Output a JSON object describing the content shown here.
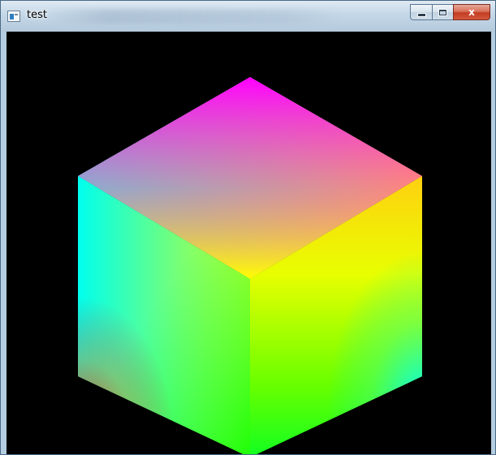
{
  "window": {
    "title": "test",
    "buttons": {
      "minimize_icon": "minimize-icon",
      "maximize_icon": "maximize-icon",
      "close_icon": "close-icon",
      "close_glyph": "x"
    }
  },
  "viewport": {
    "background": "#000000",
    "object": "rgb-color-cube",
    "vertex_colors": {
      "top": "#ff00ff",
      "upper_left": "#00ffff",
      "upper_right": "#ffffff",
      "center": "#ffff00",
      "lower_left": "#ff0000",
      "lower_right": "#00ffff",
      "bottom": "#00ff00"
    }
  }
}
